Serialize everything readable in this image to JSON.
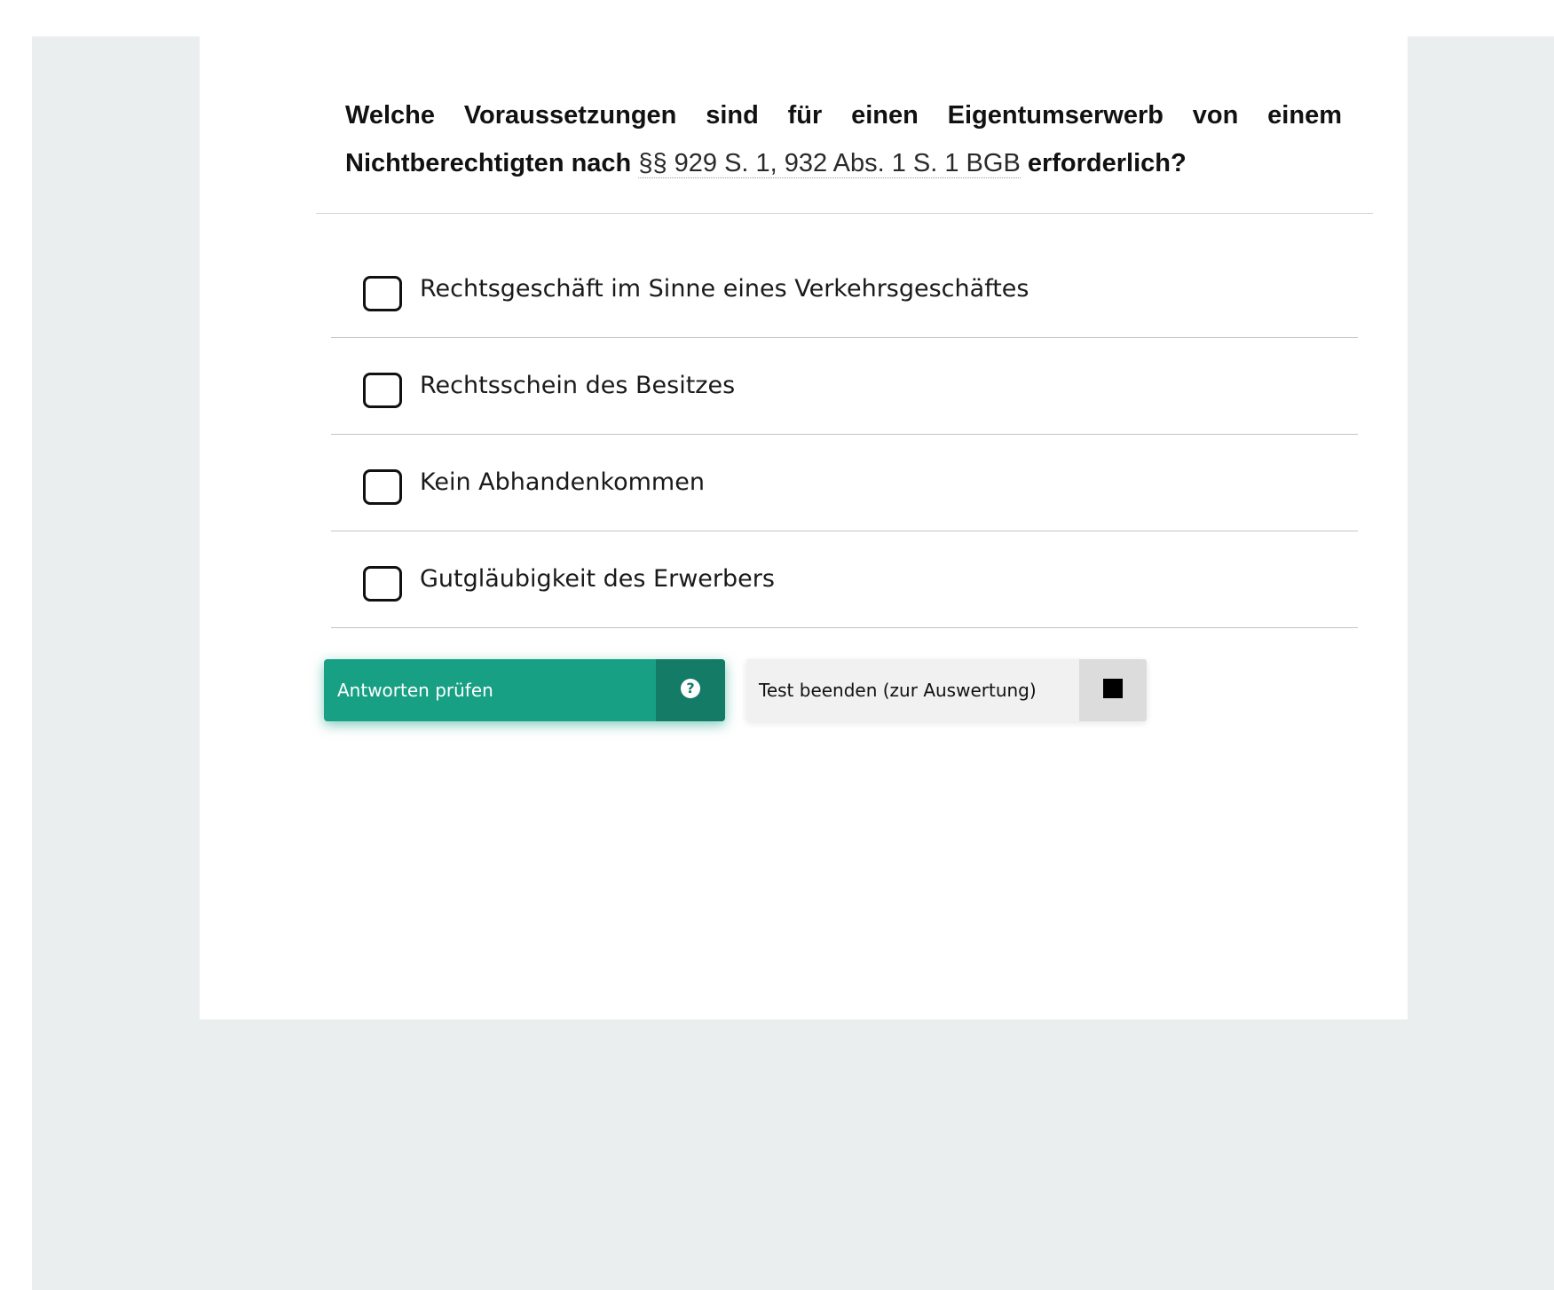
{
  "question": {
    "text_before": "Welche Voraussetzungen sind für einen Eigentumserwerb von einem Nichtberechtigten nach ",
    "reference": "§§ 929 S. 1, 932 Abs. 1 S. 1 BGB",
    "text_after": " erforderlich?"
  },
  "answers": [
    {
      "label": "Rechtsgeschäft im Sinne eines Verkehrsgeschäftes",
      "checked": false
    },
    {
      "label": "Rechtsschein des Besitzes",
      "checked": false
    },
    {
      "label": "Kein Abhandenkommen",
      "checked": false
    },
    {
      "label": "Gutgläubigkeit des Erwerbers",
      "checked": false
    }
  ],
  "buttons": {
    "check_label": "Antworten prüfen",
    "check_icon": "question-circle-icon",
    "end_label": "Test beenden (zur Auswertung)",
    "end_icon": "stop-icon"
  },
  "colors": {
    "primary": "#18a085",
    "primary_dark": "#137b66",
    "background": "#ebeeef"
  }
}
